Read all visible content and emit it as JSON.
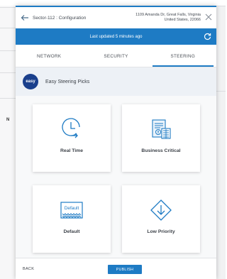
{
  "header": {
    "title": "Sector-112 : Configuration",
    "address_line1": "1109 Amanda Dr, Great Falls, Virginia",
    "address_line2": "United States, 22066"
  },
  "status_bar": {
    "text": "Last updated 5 minutes ago"
  },
  "tabs": [
    {
      "label": "NETWORK",
      "active": false
    },
    {
      "label": "SECURITY",
      "active": false
    },
    {
      "label": "STEERING",
      "active": true
    }
  ],
  "section": {
    "logo_text": "easy",
    "title": "Easy Steering Picks"
  },
  "cards": [
    {
      "label": "Real Time",
      "icon": "clock-arrow-icon"
    },
    {
      "label": "Business Critical",
      "icon": "business-document-icon"
    },
    {
      "label": "Default",
      "icon": "default-badge-icon",
      "badge_text": "Default"
    },
    {
      "label": "Low Priority",
      "icon": "down-diamond-icon"
    }
  ],
  "footer": {
    "back_label": "BACK",
    "publish_label": "PUBLISH"
  },
  "background": {
    "partial_letter": "N"
  },
  "colors": {
    "accent": "#1e7bc4",
    "easy_logo": "#1a3f8c",
    "section_bg": "#edf1f6"
  }
}
